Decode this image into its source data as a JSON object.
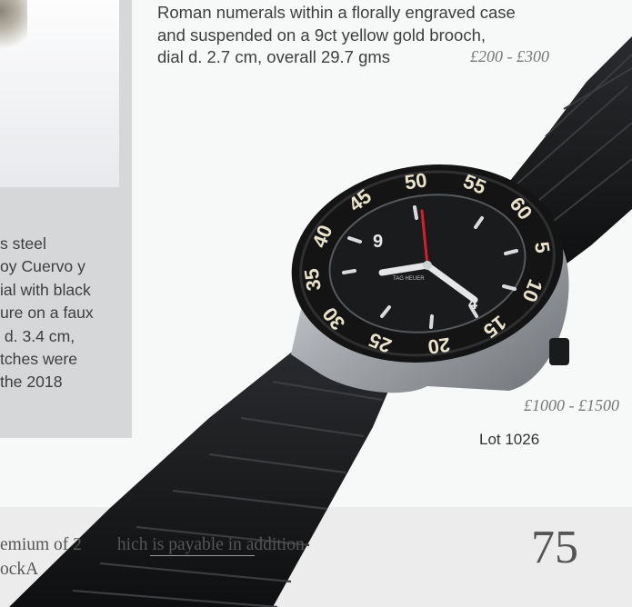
{
  "lot_right": {
    "description_lines": [
      "Roman numerals within a florally engraved case",
      "and suspended on a 9ct yellow gold brooch,",
      "dial d. 2.7 cm, overall 29.7 gms"
    ],
    "estimate": "£200 - £300",
    "lot_label": "Lot 1026"
  },
  "lot_left": {
    "description_lines": [
      "s steel",
      "oy Cuervo y",
      "ial with black",
      "ure on a faux",
      " d. 3.4 cm,",
      "tches were",
      "the 2018"
    ],
    "estimate": "£1000 - £1500"
  },
  "footer": {
    "lines": [
      "emium of 2        hich is payable in addition",
      "ockA"
    ],
    "page_number": "75"
  },
  "watch": {
    "bezel_numbers": [
      "45",
      "50",
      "55",
      "60",
      "5",
      "10",
      "15",
      "20",
      "25",
      "30",
      "35",
      "40"
    ],
    "colors": {
      "strap": "#1c1d1f",
      "bezel": "#141414",
      "dial": "#1a1b1d",
      "second_hand": "#d81e2b",
      "steel": "#b9bcbf"
    }
  }
}
